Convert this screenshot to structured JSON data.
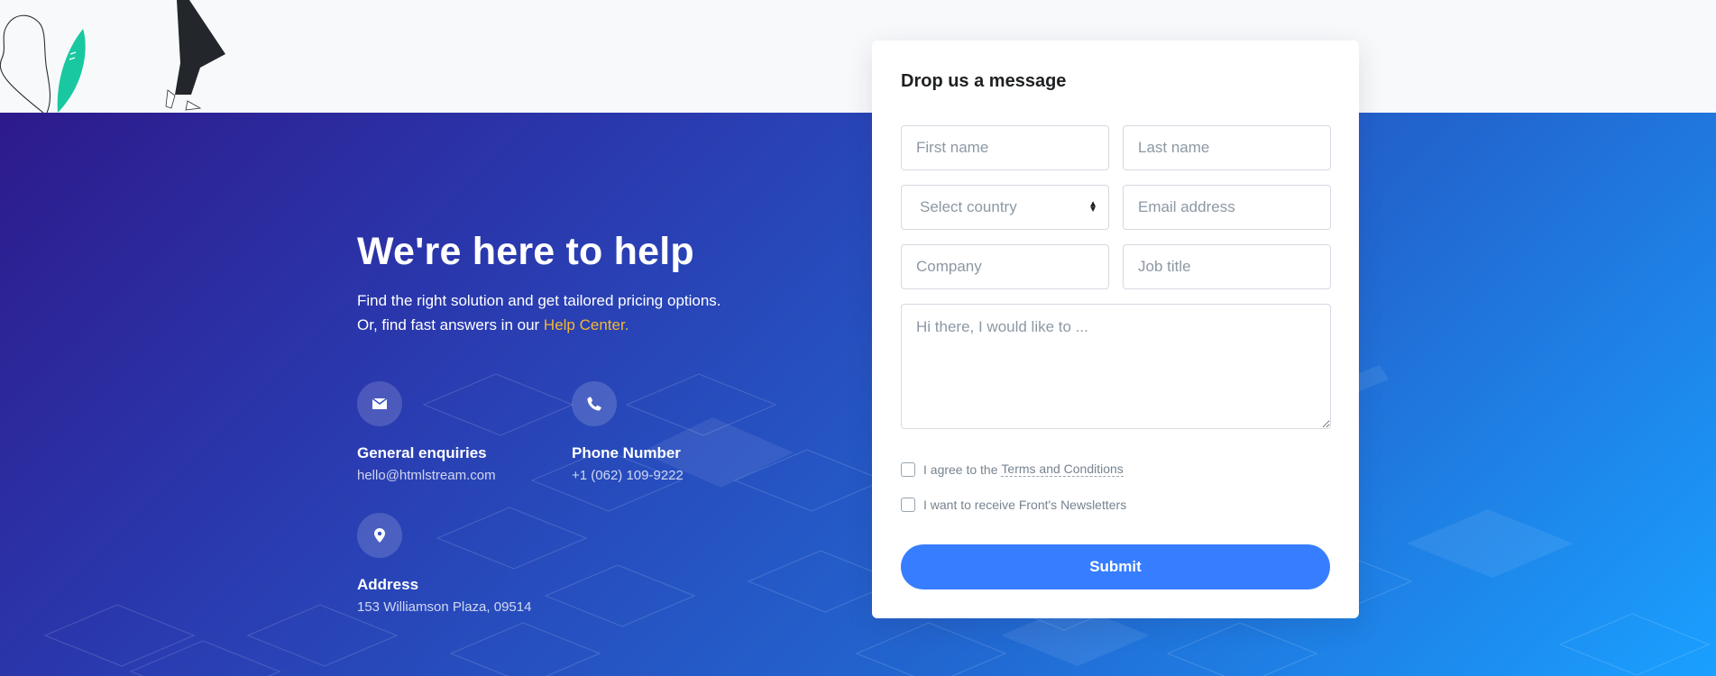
{
  "hero": {
    "headline": "We're here to help",
    "subline_1": "Find the right solution and get tailored pricing options.",
    "subline_2": "Or, find fast answers in our ",
    "help_link": "Help Center.",
    "accent_color": "#f5b732"
  },
  "contacts": [
    {
      "icon": "envelope-icon",
      "title": "General enquiries",
      "value": "hello@htmlstream.com"
    },
    {
      "icon": "phone-icon",
      "title": "Phone Number",
      "value": "+1 (062) 109-9222"
    },
    {
      "icon": "map-marker-icon",
      "title": "Address",
      "value": "153 Williamson Plaza, 09514"
    }
  ],
  "form": {
    "heading": "Drop us a message",
    "first_name_placeholder": "First name",
    "last_name_placeholder": "Last name",
    "country_selected": "Select country",
    "email_placeholder": "Email address",
    "company_placeholder": "Company",
    "job_title_placeholder": "Job title",
    "message_placeholder": "Hi there, I would like to ...",
    "terms_prefix": "I agree to the ",
    "terms_link": "Terms and Conditions",
    "newsletter_label": "I want to receive Front's Newsletters",
    "submit_label": "Submit",
    "submit_color": "#377dff"
  }
}
